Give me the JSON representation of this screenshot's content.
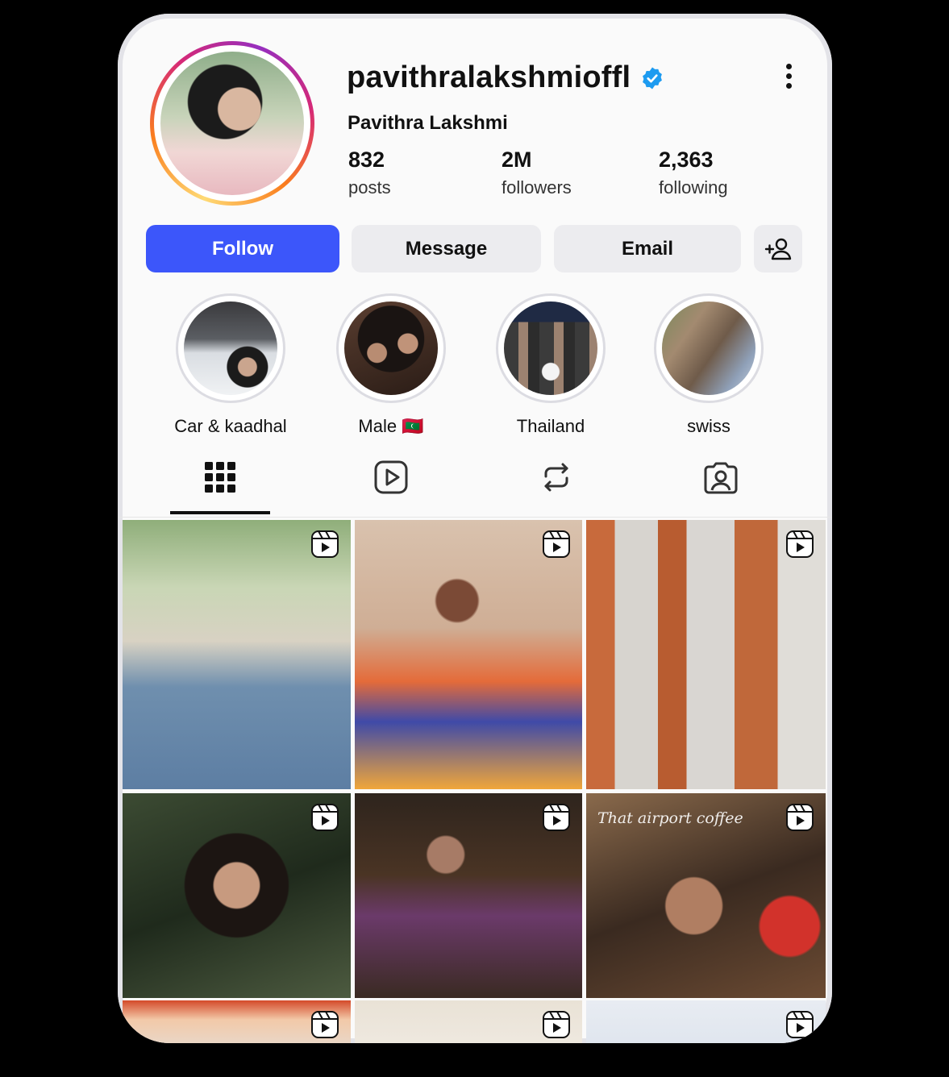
{
  "profile": {
    "username": "pavithralakshmioffl",
    "full_name": "Pavithra Lakshmi",
    "verified": true,
    "stats": [
      {
        "value": "832",
        "label": "posts"
      },
      {
        "value": "2M",
        "label": "followers"
      },
      {
        "value": "2,363",
        "label": "following"
      }
    ]
  },
  "actions": {
    "follow_label": "Follow",
    "message_label": "Message",
    "email_label": "Email"
  },
  "highlights": [
    {
      "label": "Car & kaadhal"
    },
    {
      "label": "Male 🇲🇻"
    },
    {
      "label": "Thailand"
    },
    {
      "label": "swiss"
    }
  ],
  "tabs": [
    {
      "icon": "grid-icon",
      "active": true
    },
    {
      "icon": "reels-icon",
      "active": false
    },
    {
      "icon": "reposts-icon",
      "active": false
    },
    {
      "icon": "tagged-icon",
      "active": false
    }
  ],
  "posts": [
    {
      "type": "reel",
      "caption": ""
    },
    {
      "type": "reel",
      "caption": ""
    },
    {
      "type": "reel",
      "caption": ""
    },
    {
      "type": "reel",
      "caption": ""
    },
    {
      "type": "reel",
      "caption": ""
    },
    {
      "type": "reel",
      "caption": "That airport coffee"
    },
    {
      "type": "reel",
      "caption": ""
    },
    {
      "type": "reel",
      "caption": ""
    },
    {
      "type": "reel",
      "caption": ""
    }
  ],
  "colors": {
    "follow_button": "#3c56fa",
    "secondary_button": "#ececef",
    "verified_badge": "#1d9bf0"
  }
}
